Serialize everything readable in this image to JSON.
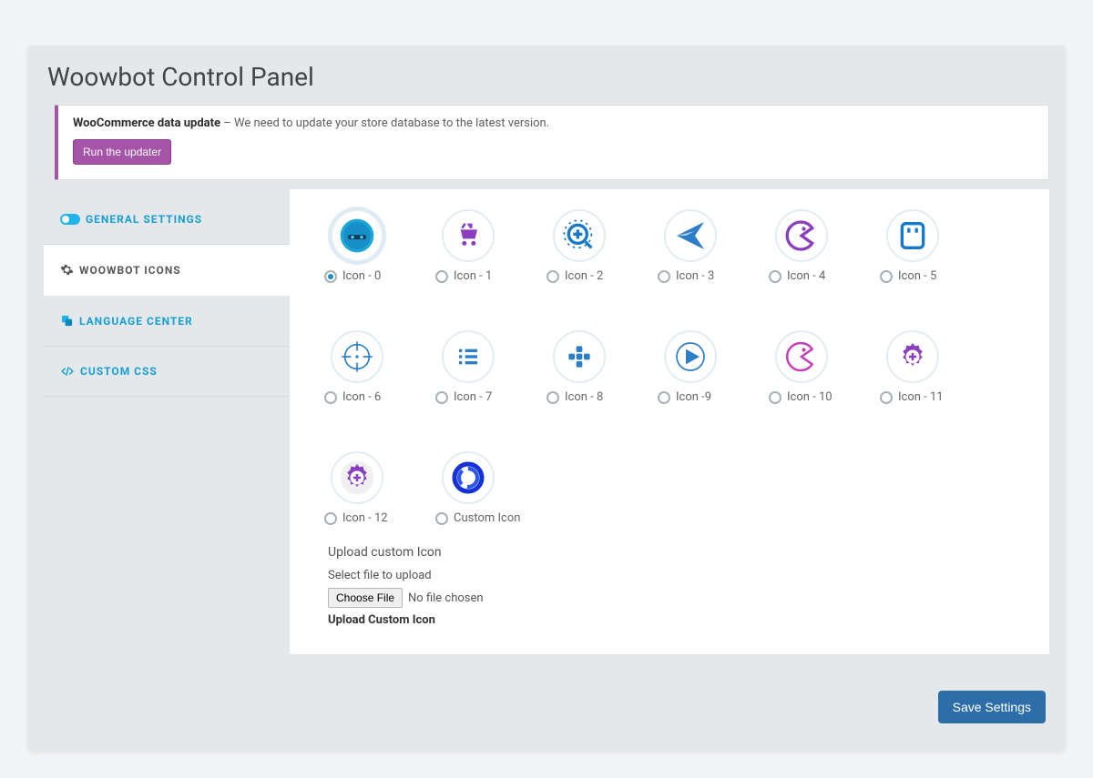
{
  "page_title": "Woowbot Control Panel",
  "notice": {
    "bold": "WooCommerce data update",
    "sep": " – ",
    "rest": "We need to update your store database to the latest version.",
    "button": "Run the updater"
  },
  "sidebar": {
    "items": [
      {
        "label": "GENERAL SETTINGS",
        "icon": "toggle",
        "active": false
      },
      {
        "label": "WOOWBOT ICONS",
        "icon": "gear",
        "active": true
      },
      {
        "label": "LANGUAGE CENTER",
        "icon": "lang",
        "active": false
      },
      {
        "label": "CUSTOM CSS",
        "icon": "code",
        "active": false
      }
    ]
  },
  "icons": [
    {
      "label": "Icon - 0",
      "kind": "bot",
      "selected": true
    },
    {
      "label": "Icon - 1",
      "kind": "cart",
      "selected": false
    },
    {
      "label": "Icon - 2",
      "kind": "zoomplus",
      "selected": false
    },
    {
      "label": "Icon - 3",
      "kind": "send",
      "selected": false
    },
    {
      "label": "Icon - 4",
      "kind": "pac-o",
      "selected": false
    },
    {
      "label": "Icon - 5",
      "kind": "panel",
      "selected": false
    },
    {
      "label": "Icon - 6",
      "kind": "target",
      "selected": false
    },
    {
      "label": "Icon - 7",
      "kind": "list",
      "selected": false
    },
    {
      "label": "Icon - 8",
      "kind": "plusgrid",
      "selected": false
    },
    {
      "label": "Icon -9",
      "kind": "play",
      "selected": false
    },
    {
      "label": "Icon - 10",
      "kind": "pac-pink",
      "selected": false
    },
    {
      "label": "Icon - 11",
      "kind": "gearplus",
      "selected": false
    },
    {
      "label": "Icon - 12",
      "kind": "gearplus2",
      "selected": false
    },
    {
      "label": "Custom Icon",
      "kind": "swirl",
      "selected": false
    }
  ],
  "upload": {
    "heading": "Upload custom Icon",
    "select_label": "Select file to upload",
    "choose_button": "Choose File",
    "no_file": "No file chosen",
    "submit_label": "Upload Custom Icon"
  },
  "save_label": "Save Settings",
  "colors": {
    "accent_blue": "#1790c9",
    "accent_purple": "#8b3fbf",
    "notice_border": "#a554a8",
    "save_btn": "#2d6ea8"
  }
}
